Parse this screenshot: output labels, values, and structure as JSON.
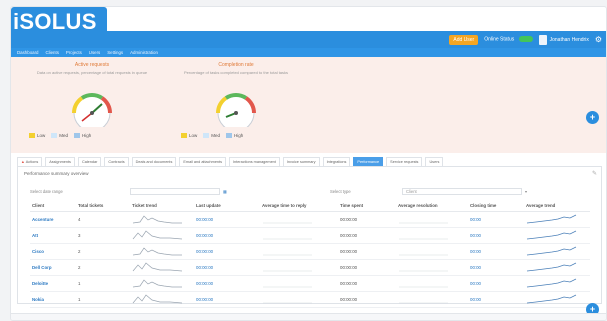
{
  "app": {
    "logo_text": "iSOLUS",
    "brand_color": "#2b8ede",
    "accent_color": "#f5a623"
  },
  "topbar": {
    "add_button": "Add User",
    "status_label": "Online Status",
    "toggle_state": "on",
    "user_name": "Jonathan Hendrix",
    "gear_icon": "gear-icon"
  },
  "nav": {
    "items": [
      "Dashboard",
      "Clients",
      "Projects",
      "Users",
      "Settings",
      "Administration"
    ]
  },
  "gauges": [
    {
      "title": "Active requests",
      "subtitle": "Data on active requests, percentage of total requests in queue",
      "value": 34,
      "legend": [
        "Low",
        "Med",
        "High"
      ]
    },
    {
      "title": "Completion rate",
      "subtitle": "Percentage of tasks completed compared to the total tasks",
      "value": 62,
      "legend": [
        "Low",
        "Med",
        "High"
      ]
    }
  ],
  "tabs": {
    "items": [
      "Actions",
      "Assignments",
      "Calendar",
      "Contracts",
      "Deals and documents",
      "Email and attachments",
      "Interactions management",
      "Invoice summary",
      "Integrations",
      "Performance",
      "Service requests",
      "Users"
    ],
    "active": "Performance"
  },
  "panel": {
    "title": "Performance summary overview"
  },
  "filters": {
    "range_label": "Select date range",
    "range_value": "",
    "type_label": "Select type",
    "type_value": "",
    "group_label": "Group by",
    "group_value": "Client"
  },
  "table": {
    "columns": [
      "Client",
      "Total tickets",
      "Ticket trend",
      "Last update",
      "Average time to reply",
      "Time spent",
      "Average resolution",
      "Closing time",
      "Average trend"
    ],
    "rows": [
      {
        "name": "Accenture",
        "tickets": "4",
        "last_update": "00:00:00",
        "time": "00:00:00",
        "closing": "00:00"
      },
      {
        "name": "Att",
        "tickets": "3",
        "last_update": "00:00:00",
        "time": "00:00:00",
        "closing": "00:00"
      },
      {
        "name": "Cisco",
        "tickets": "2",
        "last_update": "00:00:00",
        "time": "00:00:00",
        "closing": "00:00"
      },
      {
        "name": "Dell Corp",
        "tickets": "2",
        "last_update": "00:00:00",
        "time": "00:00:00",
        "closing": "00:00"
      },
      {
        "name": "Deloitte",
        "tickets": "1",
        "last_update": "00:00:00",
        "time": "00:00:00",
        "closing": "00:00"
      },
      {
        "name": "Nokia",
        "tickets": "1",
        "last_update": "00:00:00",
        "time": "00:00:00",
        "closing": "00:00"
      }
    ]
  }
}
